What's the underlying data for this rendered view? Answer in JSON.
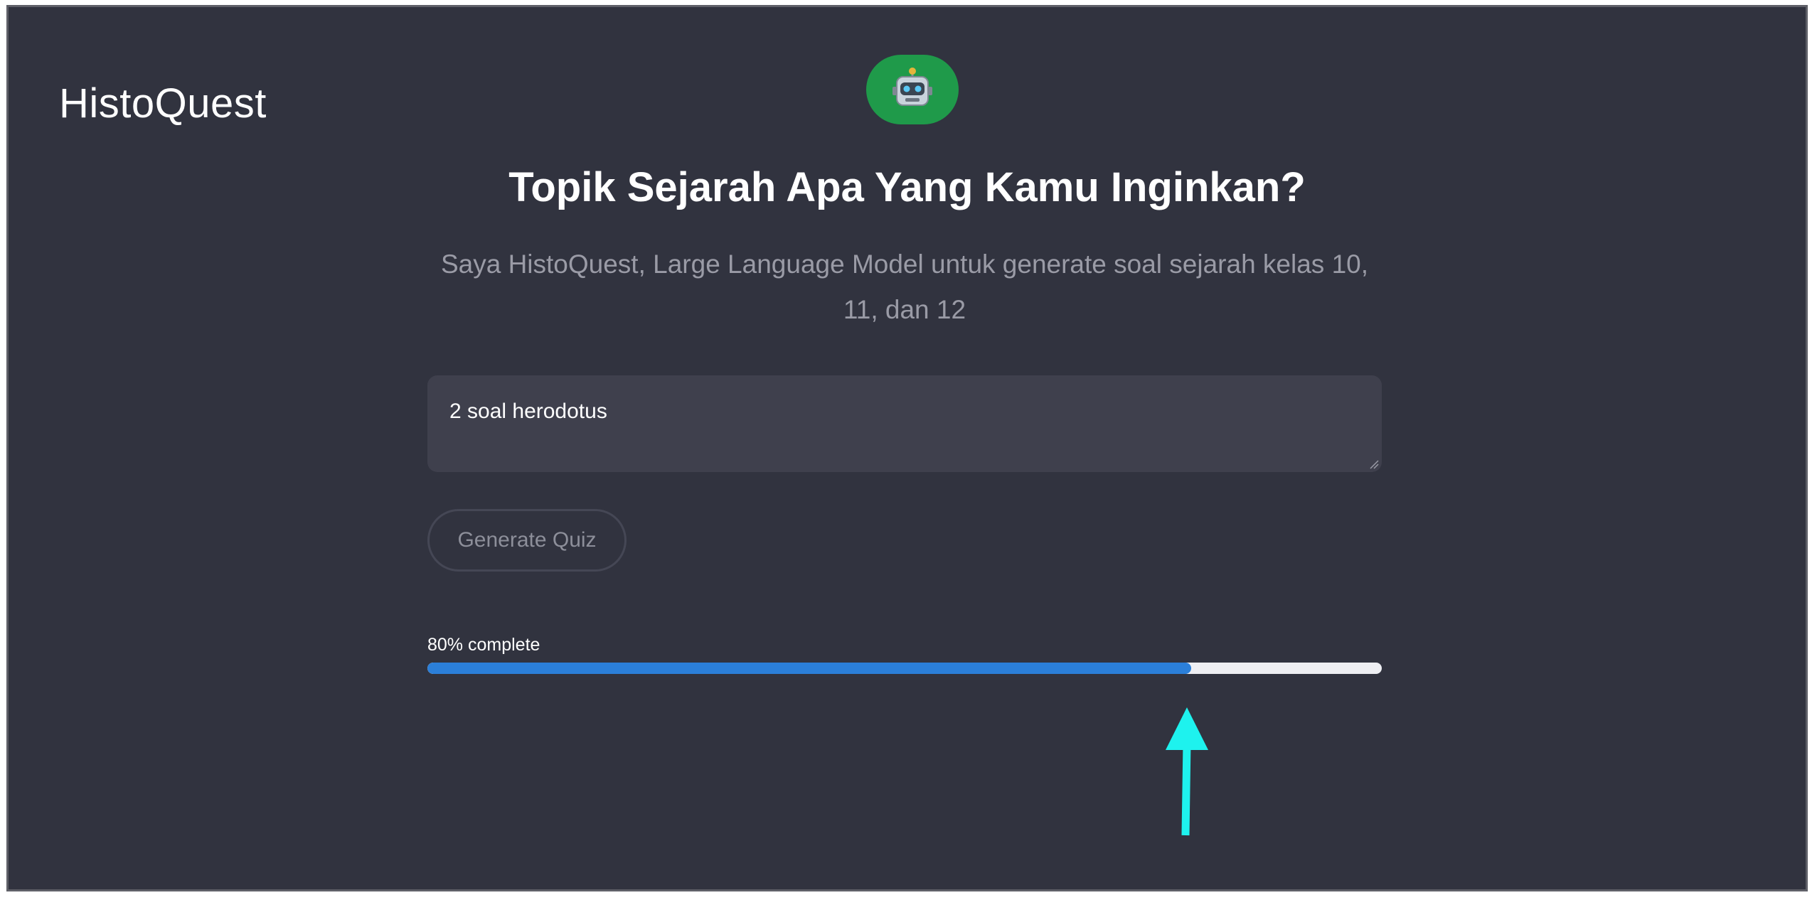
{
  "app": {
    "brand": "HistoQuest",
    "bot_avatar_icon": "robot-face-icon"
  },
  "header": {
    "title": "Topik Sejarah Apa Yang Kamu Inginkan?",
    "subtitle": "Saya HistoQuest, Large Language Model untuk generate soal sejarah kelas 10, 11, dan 12"
  },
  "prompt": {
    "value": "2 soal herodotus"
  },
  "actions": {
    "generate_label": "Generate Quiz"
  },
  "progress": {
    "label": "80% complete",
    "value": 0.8
  },
  "colors": {
    "background": "#31333f",
    "avatar_bg": "#1f9a4a",
    "progress_fill": "#2b7fd9",
    "annotation_arrow": "#1ef2ee"
  },
  "annotation": {
    "icon": "arrow-up-icon"
  }
}
